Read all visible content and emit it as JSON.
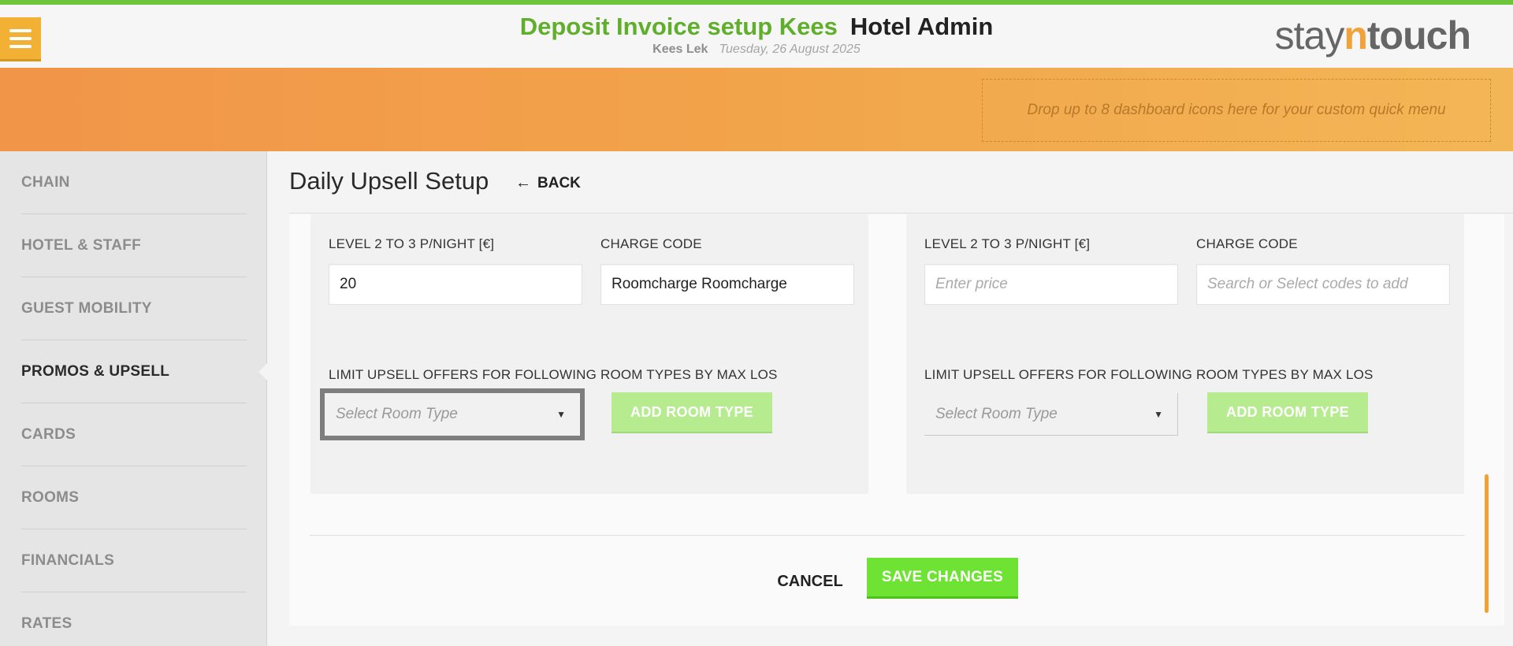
{
  "header": {
    "title_green": "Deposit Invoice setup Kees",
    "title_dark": "Hotel Admin",
    "user": "Kees Lek",
    "date": "Tuesday, 26 August 2025",
    "logo": {
      "part1": "stay",
      "part2": "n",
      "part3": "touch"
    }
  },
  "banner": {
    "drop_zone_text": "Drop up to 8 dashboard icons here for your custom quick menu"
  },
  "sidebar": {
    "items": [
      {
        "label": "CHAIN"
      },
      {
        "label": "HOTEL & STAFF"
      },
      {
        "label": "GUEST MOBILITY"
      },
      {
        "label": "PROMOS & UPSELL",
        "active": true
      },
      {
        "label": "CARDS"
      },
      {
        "label": "ROOMS"
      },
      {
        "label": "FINANCIALS"
      },
      {
        "label": "RATES"
      }
    ]
  },
  "page": {
    "title": "Daily Upsell Setup",
    "back_label": "BACK"
  },
  "panels": {
    "left": {
      "price_label": "LEVEL 2 TO 3 P/NIGHT [€]",
      "price_value": "20",
      "charge_label": "CHARGE CODE",
      "charge_value": "Roomcharge Roomcharge",
      "limit_label": "LIMIT UPSELL OFFERS FOR FOLLOWING ROOM TYPES BY MAX LOS",
      "room_select_placeholder": "Select Room Type",
      "add_room_label": "ADD ROOM TYPE"
    },
    "right": {
      "price_label": "LEVEL 2 TO 3 P/NIGHT [€]",
      "price_placeholder": "Enter price",
      "charge_label": "CHARGE CODE",
      "charge_placeholder": "Search or Select codes to add",
      "limit_label": "LIMIT UPSELL OFFERS FOR FOLLOWING ROOM TYPES BY MAX LOS",
      "room_select_placeholder": "Select Room Type",
      "add_room_label": "ADD ROOM TYPE"
    }
  },
  "footer": {
    "cancel_label": "CANCEL",
    "save_label": "SAVE CHANGES"
  },
  "colors": {
    "accent_green": "#5fae2c",
    "save_green": "#6ee334",
    "banner_orange": "#f19549",
    "menu_yellow": "#f2b134"
  }
}
